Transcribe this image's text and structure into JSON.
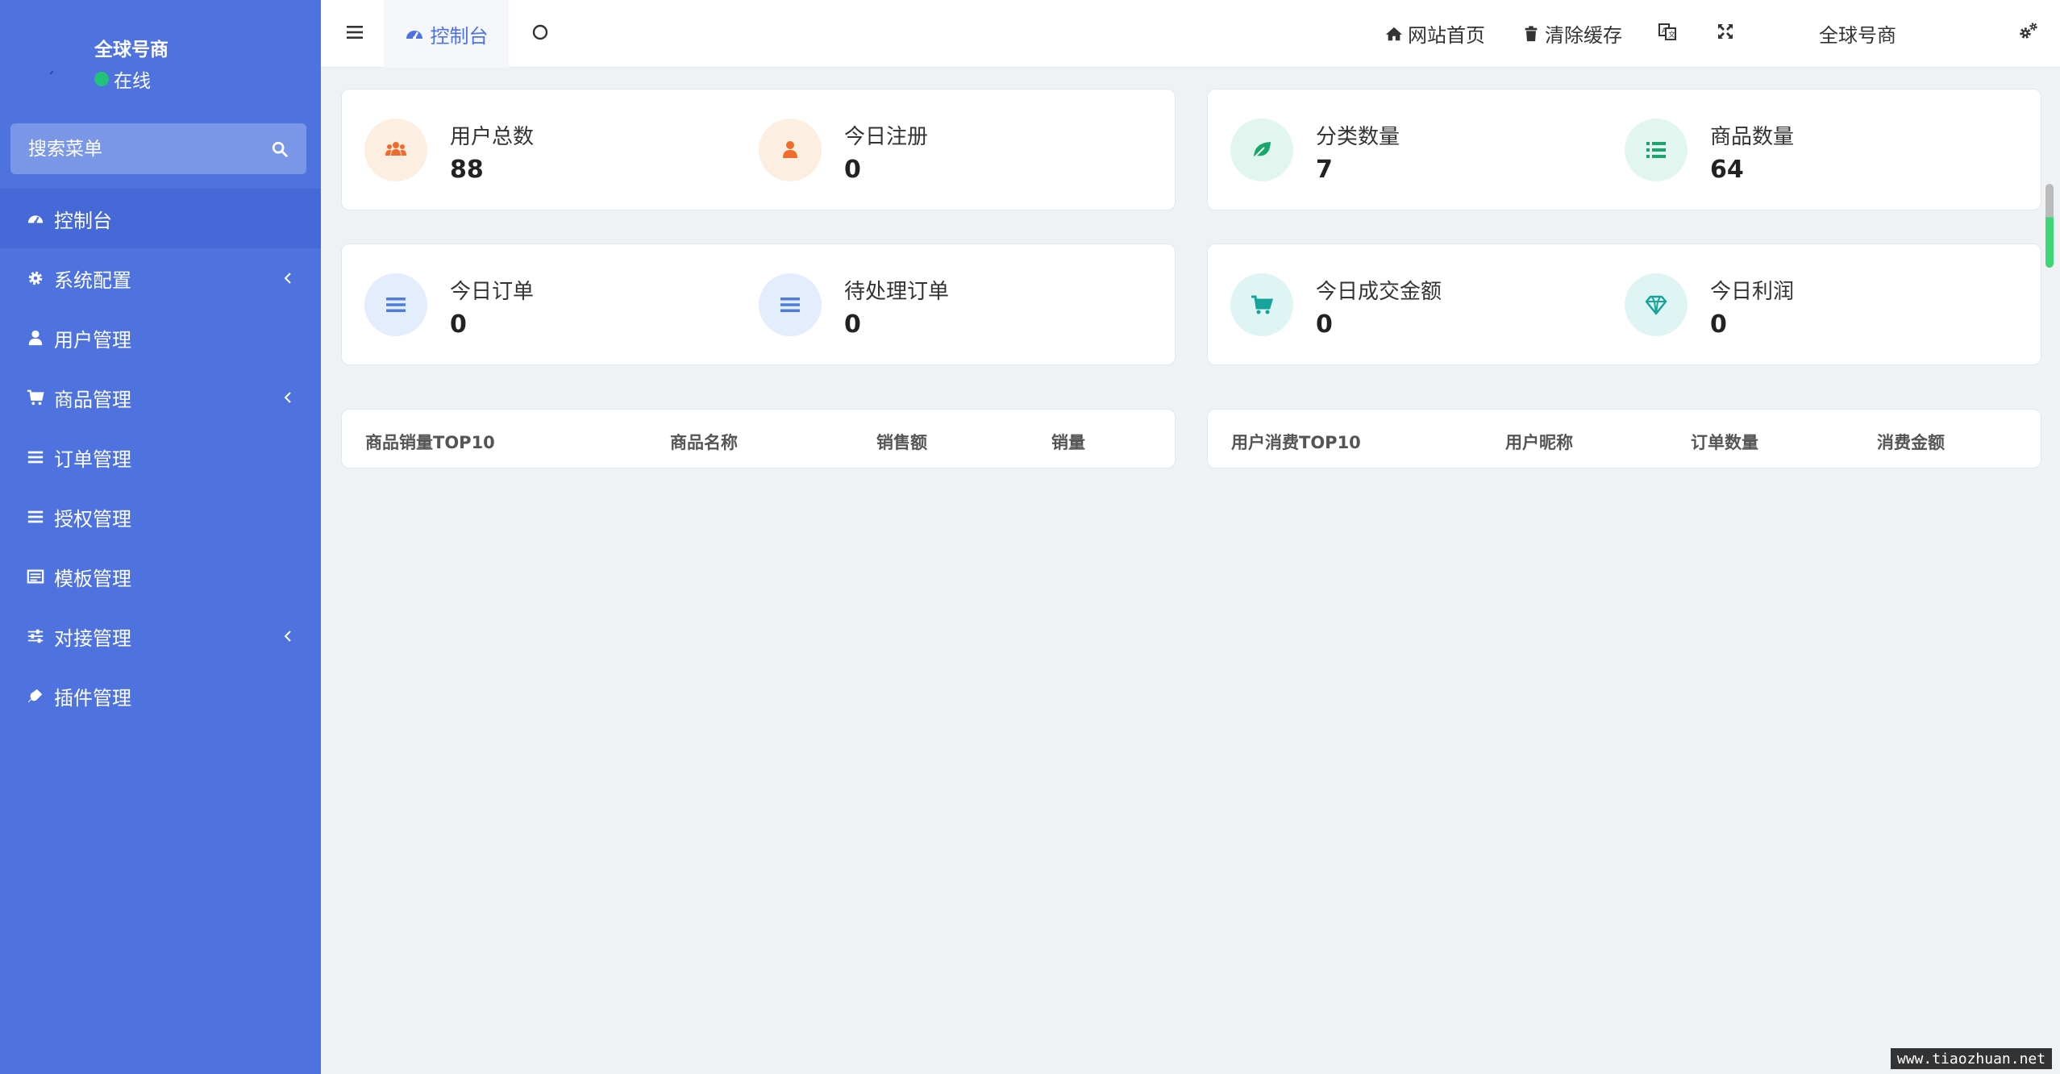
{
  "sidebar": {
    "user": {
      "name": "全球号商",
      "status": "在线"
    },
    "search": {
      "placeholder": "搜索菜单"
    },
    "items": [
      {
        "label": "控制台",
        "icon": "dashboard-icon",
        "active": true
      },
      {
        "label": "系统配置",
        "icon": "gear-icon",
        "has_children": true
      },
      {
        "label": "用户管理",
        "icon": "user-icon"
      },
      {
        "label": "商品管理",
        "icon": "cart-icon",
        "has_children": true
      },
      {
        "label": "订单管理",
        "icon": "list-icon"
      },
      {
        "label": "授权管理",
        "icon": "list-icon"
      },
      {
        "label": "模板管理",
        "icon": "template-icon"
      },
      {
        "label": "对接管理",
        "icon": "sliders-icon",
        "has_children": true
      },
      {
        "label": "插件管理",
        "icon": "plug-icon"
      }
    ]
  },
  "header": {
    "tab": "控制台",
    "links": {
      "home": "网站首页",
      "clear_cache": "清除缓存"
    },
    "username": "全球号商"
  },
  "stats": [
    {
      "label": "用户总数",
      "value": "88",
      "icon": "users-icon",
      "bg": "#fdeee2",
      "fg": "#ef6c2c"
    },
    {
      "label": "今日注册",
      "value": "0",
      "icon": "user-icon",
      "bg": "#fdeee2",
      "fg": "#ef6c2c"
    },
    {
      "label": "分类数量",
      "value": "7",
      "icon": "leaf-icon",
      "bg": "#e1f6ee",
      "fg": "#1aa56b"
    },
    {
      "label": "商品数量",
      "value": "64",
      "icon": "list-icon",
      "bg": "#e1f6ee",
      "fg": "#1aa56b"
    },
    {
      "label": "今日订单",
      "value": "0",
      "icon": "bars-icon",
      "bg": "#e3edfb",
      "fg": "#4e7ddb"
    },
    {
      "label": "待处理订单",
      "value": "0",
      "icon": "bars-icon",
      "bg": "#e3edfb",
      "fg": "#4e7ddb"
    },
    {
      "label": "今日成交金额",
      "value": "0",
      "icon": "cart-icon",
      "bg": "#dff5f4",
      "fg": "#16a39b"
    },
    {
      "label": "今日利润",
      "value": "0",
      "icon": "diamond-icon",
      "bg": "#dff5f4",
      "fg": "#16a39b"
    }
  ],
  "tables": {
    "goods": {
      "headers": [
        "商品销量TOP10",
        "商品名称",
        "销售额",
        "销量"
      ]
    },
    "users": {
      "headers": [
        "用户消费TOP10",
        "用户昵称",
        "订单数量",
        "消费金额"
      ]
    }
  },
  "watermark": "www.tiaozhuan.net",
  "colors": {
    "sidebar": "#4e73df",
    "accent": "#4e73df",
    "page_bg": "#eff2f5"
  }
}
